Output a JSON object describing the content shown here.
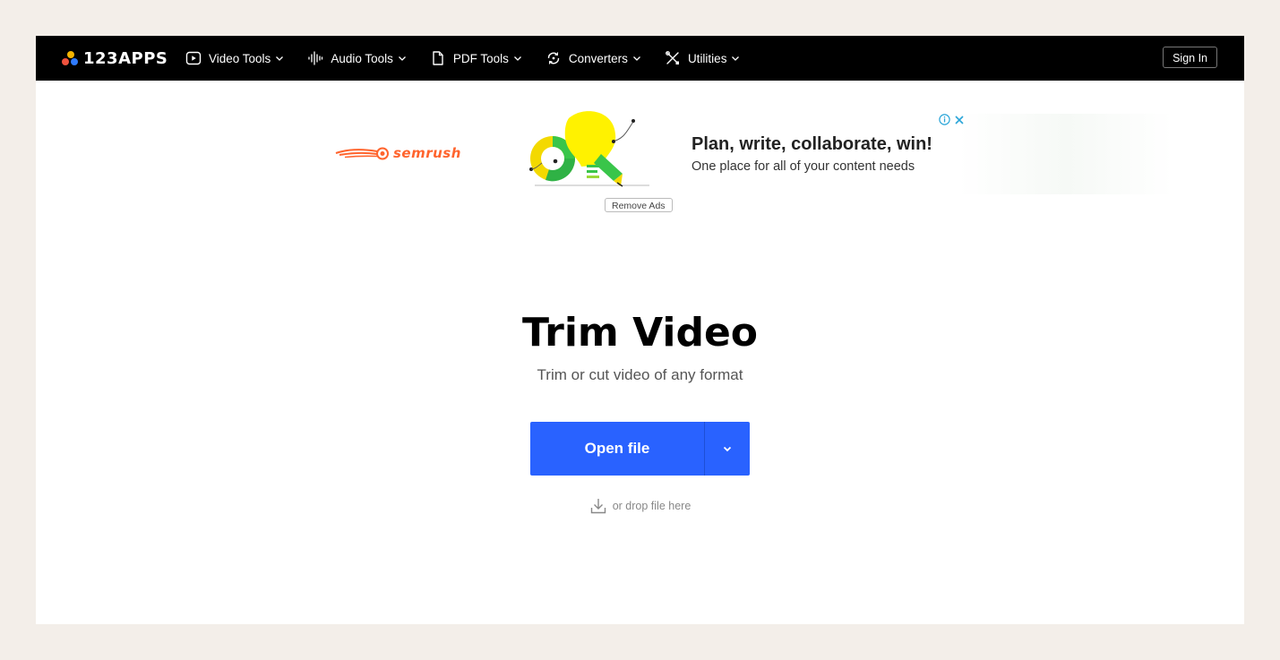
{
  "nav": {
    "logo_text": "123APPS",
    "menu": [
      {
        "label": "Video Tools",
        "icon": "play-icon"
      },
      {
        "label": "Audio Tools",
        "icon": "waveform-icon"
      },
      {
        "label": "PDF Tools",
        "icon": "document-icon"
      },
      {
        "label": "Converters",
        "icon": "convert-icon"
      },
      {
        "label": "Utilities",
        "icon": "tools-icon"
      }
    ],
    "sign_in": "Sign In"
  },
  "ad": {
    "brand": "semrush",
    "title": "Plan, write, collaborate, win!",
    "subtitle": "One place for all of your content needs",
    "remove_ads": "Remove Ads"
  },
  "hero": {
    "title": "Trim Video",
    "subtitle": "Trim or cut video of any format",
    "open_file": "Open file",
    "drop_hint": "or drop file here"
  },
  "colors": {
    "nav_bg": "#000000",
    "primary": "#2962ff",
    "page_bg": "#f3eee9",
    "semrush": "#ff642d"
  }
}
